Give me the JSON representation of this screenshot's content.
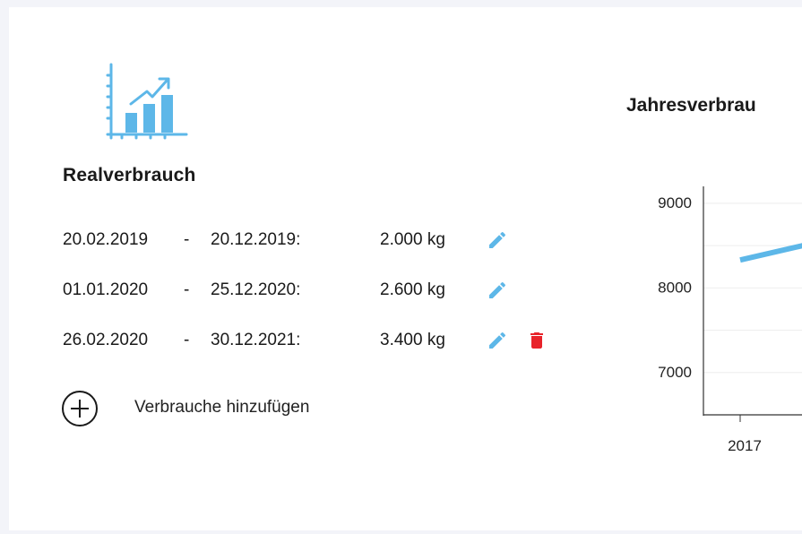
{
  "section": {
    "title": "Realverbrauch",
    "logo_icon": "bar-chart-growth-icon"
  },
  "entries": [
    {
      "start": "20.02.2019",
      "separator": "-",
      "end": "20.12.2019:",
      "amount": "2.000 kg",
      "editable": true,
      "deletable": false
    },
    {
      "start": "01.01.2020",
      "separator": "-",
      "end": "25.12.2020:",
      "amount": "2.600 kg",
      "editable": true,
      "deletable": false
    },
    {
      "start": "26.02.2020",
      "separator": "-",
      "end": "30.12.2021:",
      "amount": "3.400 kg",
      "editable": true,
      "deletable": true
    }
  ],
  "add": {
    "label": "Verbrauche hinzufügen",
    "icon": "plus-circle-icon"
  },
  "chart_data": {
    "type": "line",
    "title": "Jahresverbrau",
    "x": [
      "2017"
    ],
    "series": [
      {
        "values": [
          8330
        ]
      }
    ],
    "yticks": [
      "9000",
      "8000",
      "7000"
    ],
    "ylim": [
      6500,
      9200
    ],
    "grid": true
  },
  "colors": {
    "accent": "#5db7e8",
    "delete": "#e8232a",
    "background": "#f3f4f9",
    "card": "#ffffff"
  }
}
